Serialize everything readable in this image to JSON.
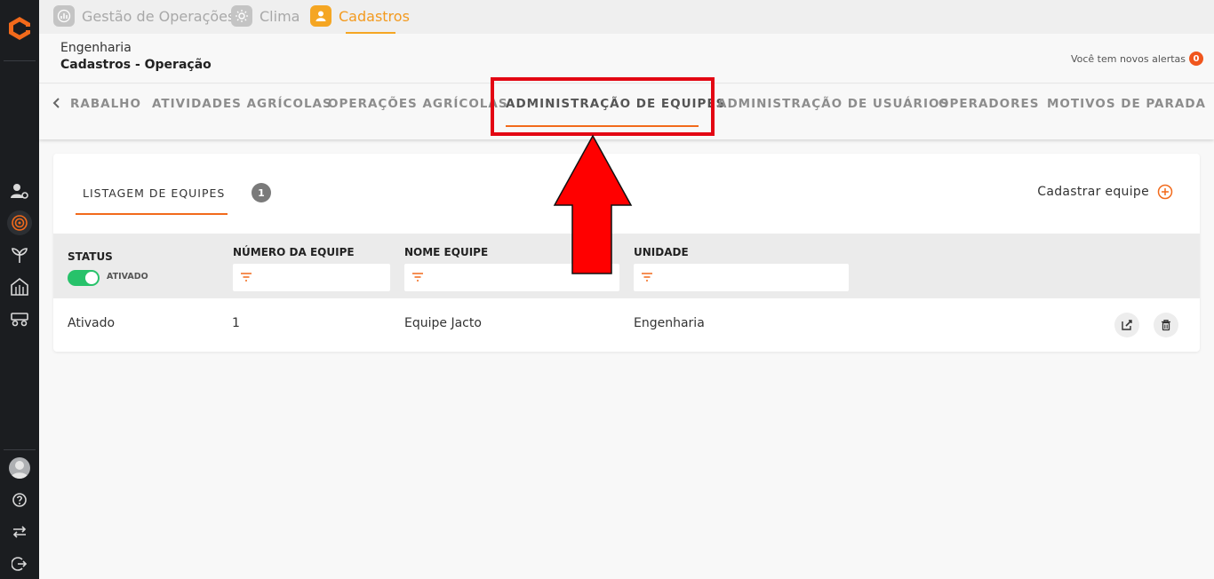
{
  "app_tabs": [
    {
      "label": "Gestão de Operações",
      "icon": "chart-icon"
    },
    {
      "label": "Clima",
      "icon": "sun-icon"
    },
    {
      "label": "Cadastros",
      "icon": "user-icon"
    }
  ],
  "header": {
    "unit": "Engenharia",
    "page": "Cadastros - Operação",
    "alerts_label": "Você tem novos alertas",
    "alerts_count": "0"
  },
  "sub_tabs": [
    "RABALHO",
    "ATIVIDADES AGRÍCOLAS",
    "OPERAÇÕES AGRÍCOLAS",
    "ADMINISTRAÇÃO DE EQUIPES",
    "ADMINISTRAÇÃO DE USUÁRIOS",
    "OPERADORES",
    "MOTIVOS DE PARADA"
  ],
  "listing": {
    "tab_label": "LISTAGEM DE EQUIPES",
    "count": "1",
    "add_label": "Cadastrar equipe"
  },
  "table": {
    "columns": [
      "STATUS",
      "NÚMERO DA EQUIPE",
      "NOME EQUIPE",
      "UNIDADE"
    ],
    "status_filter_label": "ATIVADO",
    "rows": [
      {
        "status": "Ativado",
        "number": "1",
        "name": "Equipe Jacto",
        "unit": "Engenharia"
      }
    ]
  },
  "colors": {
    "accent": "#f26a1b",
    "app_active": "#f5a623",
    "toggle_on": "#27c26a",
    "highlight": "#e30613"
  }
}
